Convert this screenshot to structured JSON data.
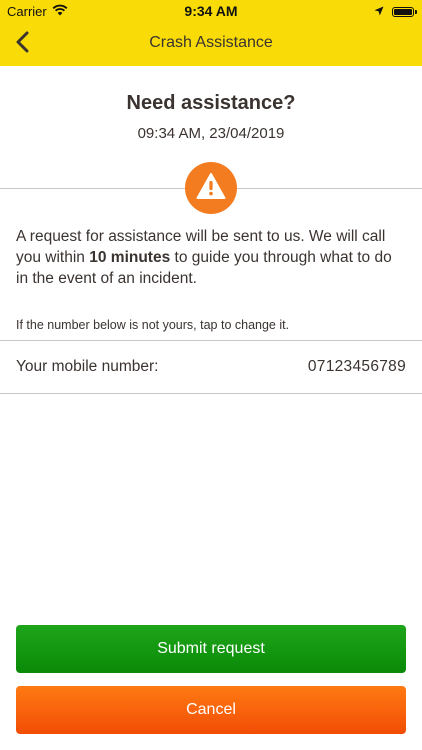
{
  "status_bar": {
    "carrier": "Carrier",
    "time": "9:34 AM",
    "icons": [
      "wifi-icon",
      "location-arrow-icon",
      "battery-icon"
    ]
  },
  "nav": {
    "title": "Crash Assistance",
    "back_icon": "chevron-left-icon"
  },
  "content": {
    "heading": "Need assistance?",
    "timestamp": "09:34 AM, 23/04/2019",
    "warning_icon": "warning-triangle-icon",
    "info_before": "A request for assistance will be sent to us. We will call you within ",
    "info_bold": "10 minutes",
    "info_after": " to guide you through what to do in the event of an incident.",
    "hint": "If the number below is not yours, tap to change it.",
    "mobile_label": "Your mobile number:",
    "mobile_value": "07123456789"
  },
  "actions": {
    "submit_label": "Submit request",
    "cancel_label": "Cancel"
  },
  "colors": {
    "brand_yellow": "#f9dc07",
    "warning_orange": "#f47c20",
    "submit_green": "#13981a",
    "cancel_orange": "#f55a08"
  }
}
